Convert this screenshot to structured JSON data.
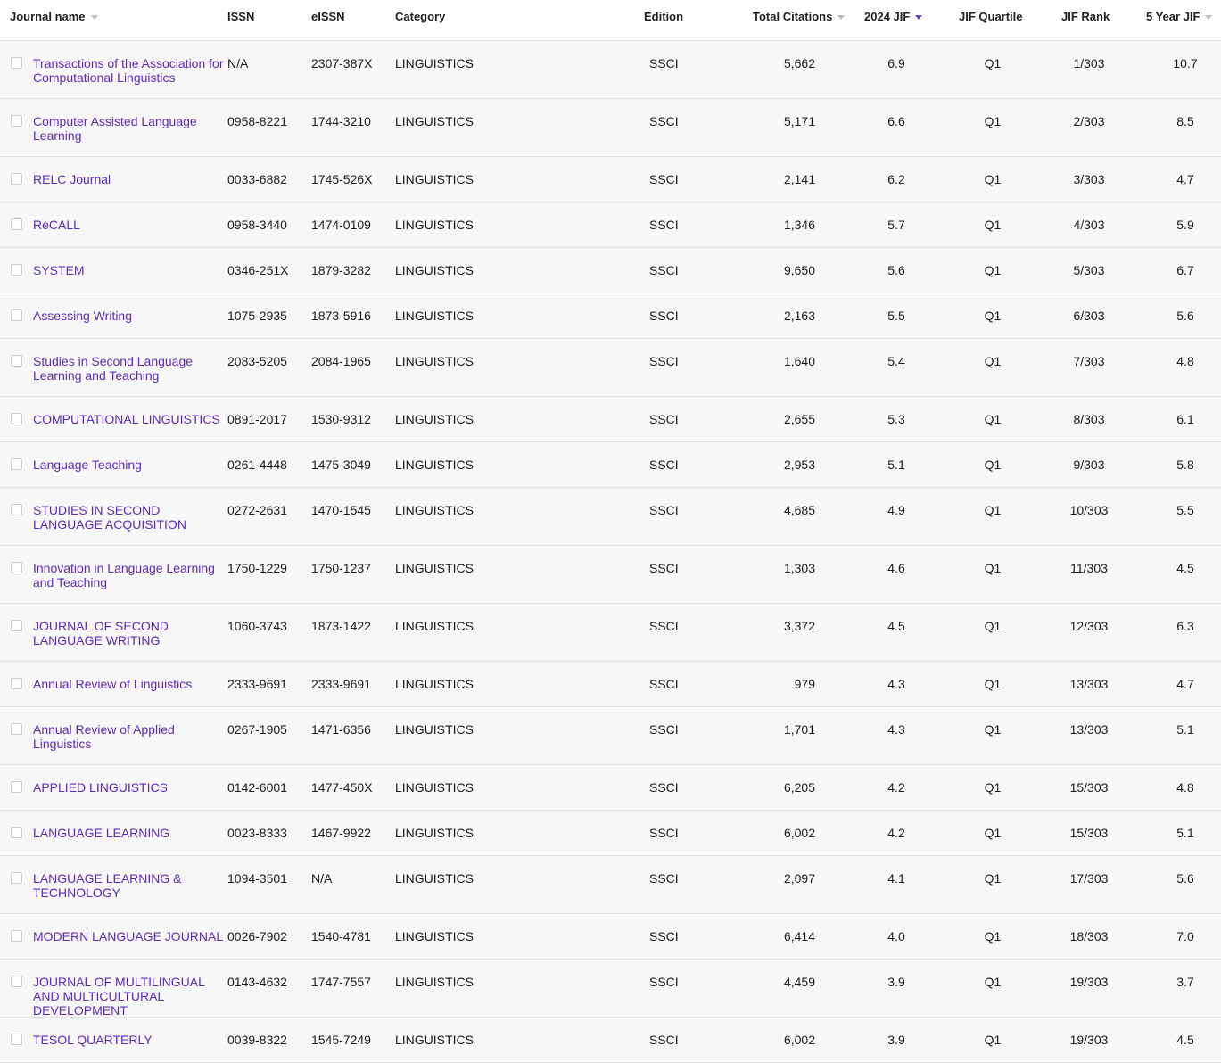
{
  "colors": {
    "link": "#5b2bb8",
    "sort_active": "#6a3fc4",
    "row_bg": "#f7f7f7",
    "divider": "#e3e3e3"
  },
  "headers": {
    "journal_name": "Journal name",
    "issn": "ISSN",
    "eissn": "eISSN",
    "category": "Category",
    "edition": "Edition",
    "total_citations": "Total Citations",
    "jif": "2024 JIF",
    "jif_quartile": "JIF Quartile",
    "jif_rank": "JIF Rank",
    "five_year_jif": "5 Year JIF"
  },
  "rows": [
    {
      "name": "Transactions of the Association for Computational Linguistics",
      "issn": "N/A",
      "eissn": "2307-387X",
      "category": "LINGUISTICS",
      "edition": "SSCI",
      "citations": "5,662",
      "jif": "6.9",
      "quartile": "Q1",
      "rank": "1/303",
      "five_year": "10.7"
    },
    {
      "name": "Computer Assisted Language Learning",
      "issn": "0958-8221",
      "eissn": "1744-3210",
      "category": "LINGUISTICS",
      "edition": "SSCI",
      "citations": "5,171",
      "jif": "6.6",
      "quartile": "Q1",
      "rank": "2/303",
      "five_year": "8.5"
    },
    {
      "name": "RELC Journal",
      "issn": "0033-6882",
      "eissn": "1745-526X",
      "category": "LINGUISTICS",
      "edition": "SSCI",
      "citations": "2,141",
      "jif": "6.2",
      "quartile": "Q1",
      "rank": "3/303",
      "five_year": "4.7"
    },
    {
      "name": "ReCALL",
      "issn": "0958-3440",
      "eissn": "1474-0109",
      "category": "LINGUISTICS",
      "edition": "SSCI",
      "citations": "1,346",
      "jif": "5.7",
      "quartile": "Q1",
      "rank": "4/303",
      "five_year": "5.9"
    },
    {
      "name": "SYSTEM",
      "issn": "0346-251X",
      "eissn": "1879-3282",
      "category": "LINGUISTICS",
      "edition": "SSCI",
      "citations": "9,650",
      "jif": "5.6",
      "quartile": "Q1",
      "rank": "5/303",
      "five_year": "6.7"
    },
    {
      "name": "Assessing Writing",
      "issn": "1075-2935",
      "eissn": "1873-5916",
      "category": "LINGUISTICS",
      "edition": "SSCI",
      "citations": "2,163",
      "jif": "5.5",
      "quartile": "Q1",
      "rank": "6/303",
      "five_year": "5.6"
    },
    {
      "name": "Studies in Second Language Learning and Teaching",
      "issn": "2083-5205",
      "eissn": "2084-1965",
      "category": "LINGUISTICS",
      "edition": "SSCI",
      "citations": "1,640",
      "jif": "5.4",
      "quartile": "Q1",
      "rank": "7/303",
      "five_year": "4.8"
    },
    {
      "name": "COMPUTATIONAL LINGUISTICS",
      "issn": "0891-2017",
      "eissn": "1530-9312",
      "category": "LINGUISTICS",
      "edition": "SSCI",
      "citations": "2,655",
      "jif": "5.3",
      "quartile": "Q1",
      "rank": "8/303",
      "five_year": "6.1"
    },
    {
      "name": "Language Teaching",
      "issn": "0261-4448",
      "eissn": "1475-3049",
      "category": "LINGUISTICS",
      "edition": "SSCI",
      "citations": "2,953",
      "jif": "5.1",
      "quartile": "Q1",
      "rank": "9/303",
      "five_year": "5.8"
    },
    {
      "name": "STUDIES IN SECOND LANGUAGE ACQUISITION",
      "issn": "0272-2631",
      "eissn": "1470-1545",
      "category": "LINGUISTICS",
      "edition": "SSCI",
      "citations": "4,685",
      "jif": "4.9",
      "quartile": "Q1",
      "rank": "10/303",
      "five_year": "5.5"
    },
    {
      "name": "Innovation in Language Learning and Teaching",
      "issn": "1750-1229",
      "eissn": "1750-1237",
      "category": "LINGUISTICS",
      "edition": "SSCI",
      "citations": "1,303",
      "jif": "4.6",
      "quartile": "Q1",
      "rank": "11/303",
      "five_year": "4.5"
    },
    {
      "name": "JOURNAL OF SECOND LANGUAGE WRITING",
      "issn": "1060-3743",
      "eissn": "1873-1422",
      "category": "LINGUISTICS",
      "edition": "SSCI",
      "citations": "3,372",
      "jif": "4.5",
      "quartile": "Q1",
      "rank": "12/303",
      "five_year": "6.3"
    },
    {
      "name": "Annual Review of Linguistics",
      "issn": "2333-9691",
      "eissn": "2333-9691",
      "category": "LINGUISTICS",
      "edition": "SSCI",
      "citations": "979",
      "jif": "4.3",
      "quartile": "Q1",
      "rank": "13/303",
      "five_year": "4.7"
    },
    {
      "name": "Annual Review of Applied Linguistics",
      "issn": "0267-1905",
      "eissn": "1471-6356",
      "category": "LINGUISTICS",
      "edition": "SSCI",
      "citations": "1,701",
      "jif": "4.3",
      "quartile": "Q1",
      "rank": "13/303",
      "five_year": "5.1"
    },
    {
      "name": "APPLIED LINGUISTICS",
      "issn": "0142-6001",
      "eissn": "1477-450X",
      "category": "LINGUISTICS",
      "edition": "SSCI",
      "citations": "6,205",
      "jif": "4.2",
      "quartile": "Q1",
      "rank": "15/303",
      "five_year": "4.8"
    },
    {
      "name": "LANGUAGE LEARNING",
      "issn": "0023-8333",
      "eissn": "1467-9922",
      "category": "LINGUISTICS",
      "edition": "SSCI",
      "citations": "6,002",
      "jif": "4.2",
      "quartile": "Q1",
      "rank": "15/303",
      "five_year": "5.1"
    },
    {
      "name": "LANGUAGE LEARNING & TECHNOLOGY",
      "issn": "1094-3501",
      "eissn": "N/A",
      "category": "LINGUISTICS",
      "edition": "SSCI",
      "citations": "2,097",
      "jif": "4.1",
      "quartile": "Q1",
      "rank": "17/303",
      "five_year": "5.6"
    },
    {
      "name": "MODERN LANGUAGE JOURNAL",
      "issn": "0026-7902",
      "eissn": "1540-4781",
      "category": "LINGUISTICS",
      "edition": "SSCI",
      "citations": "6,414",
      "jif": "4.0",
      "quartile": "Q1",
      "rank": "18/303",
      "five_year": "7.0"
    },
    {
      "name": "JOURNAL OF MULTILINGUAL AND MULTICULTURAL DEVELOPMENT",
      "issn": "0143-4632",
      "eissn": "1747-7557",
      "category": "LINGUISTICS",
      "edition": "SSCI",
      "citations": "4,459",
      "jif": "3.9",
      "quartile": "Q1",
      "rank": "19/303",
      "five_year": "3.7"
    },
    {
      "name": "TESOL QUARTERLY",
      "issn": "0039-8322",
      "eissn": "1545-7249",
      "category": "LINGUISTICS",
      "edition": "SSCI",
      "citations": "6,002",
      "jif": "3.9",
      "quartile": "Q1",
      "rank": "19/303",
      "five_year": "4.5"
    }
  ]
}
